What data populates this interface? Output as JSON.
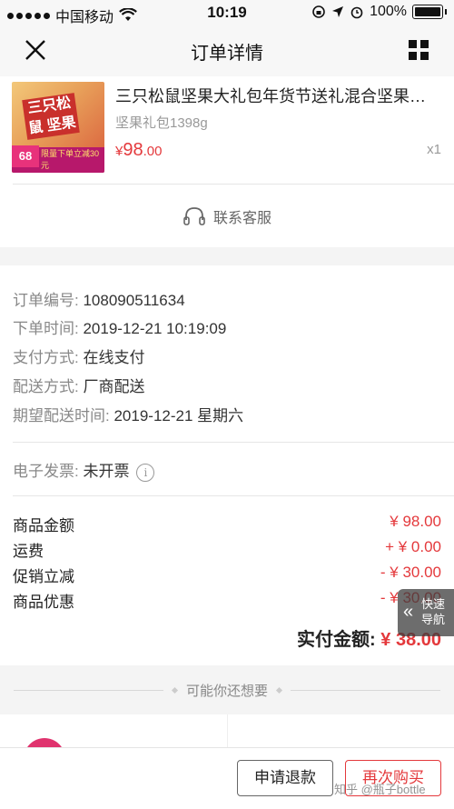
{
  "status_bar": {
    "carrier": "中国移动",
    "time": "10:19",
    "battery": "100%"
  },
  "nav": {
    "title": "订单详情",
    "close_icon": "close-icon",
    "menu_icon": "grid-menu-icon"
  },
  "product": {
    "title": "三只松鼠坚果大礼包年货节送礼混合坚果…",
    "spec": "坚果礼包1398g",
    "price_symbol": "¥",
    "price_int": "98",
    "price_dec": ".00",
    "quantity": "x1",
    "thumb_price": "68",
    "thumb_tagline": "限量下单立减30元",
    "thumb_box_text": "三只松鼠 坚果"
  },
  "service": {
    "label": "联系客服",
    "icon": "headset-icon"
  },
  "order_info": {
    "order_no_label": "订单编号:",
    "order_no": "108090511634",
    "order_time_label": "下单时间:",
    "order_time": "2019-12-21 10:19:09",
    "pay_label": "支付方式:",
    "pay": "在线支付",
    "delivery_label": "配送方式:",
    "delivery": "厂商配送",
    "expected_label": "期望配送时间:",
    "expected": "2019-12-21 星期六",
    "invoice_label": "电子发票:",
    "invoice": "未开票",
    "invoice_icon": "info-icon"
  },
  "amounts": {
    "goods_label": "商品金额",
    "goods": "¥ 98.00",
    "freight_label": "运费",
    "freight": "+ ¥ 0.00",
    "promo_label": "促销立减",
    "promo": "- ¥ 30.00",
    "discount_label": "商品优惠",
    "discount": "- ¥ 30.00",
    "total_label": "实付金额:",
    "total": "¥ 38.00"
  },
  "quick_nav": {
    "line1": "快速",
    "line2": "导航"
  },
  "recommend": {
    "title": "可能你还想要"
  },
  "actions": {
    "refund": "申请退款",
    "rebuy": "再次购买"
  },
  "watermark": "知乎 @瓶子bottle",
  "colors": {
    "accent": "#e4393c",
    "background": "#f4f4f4"
  }
}
